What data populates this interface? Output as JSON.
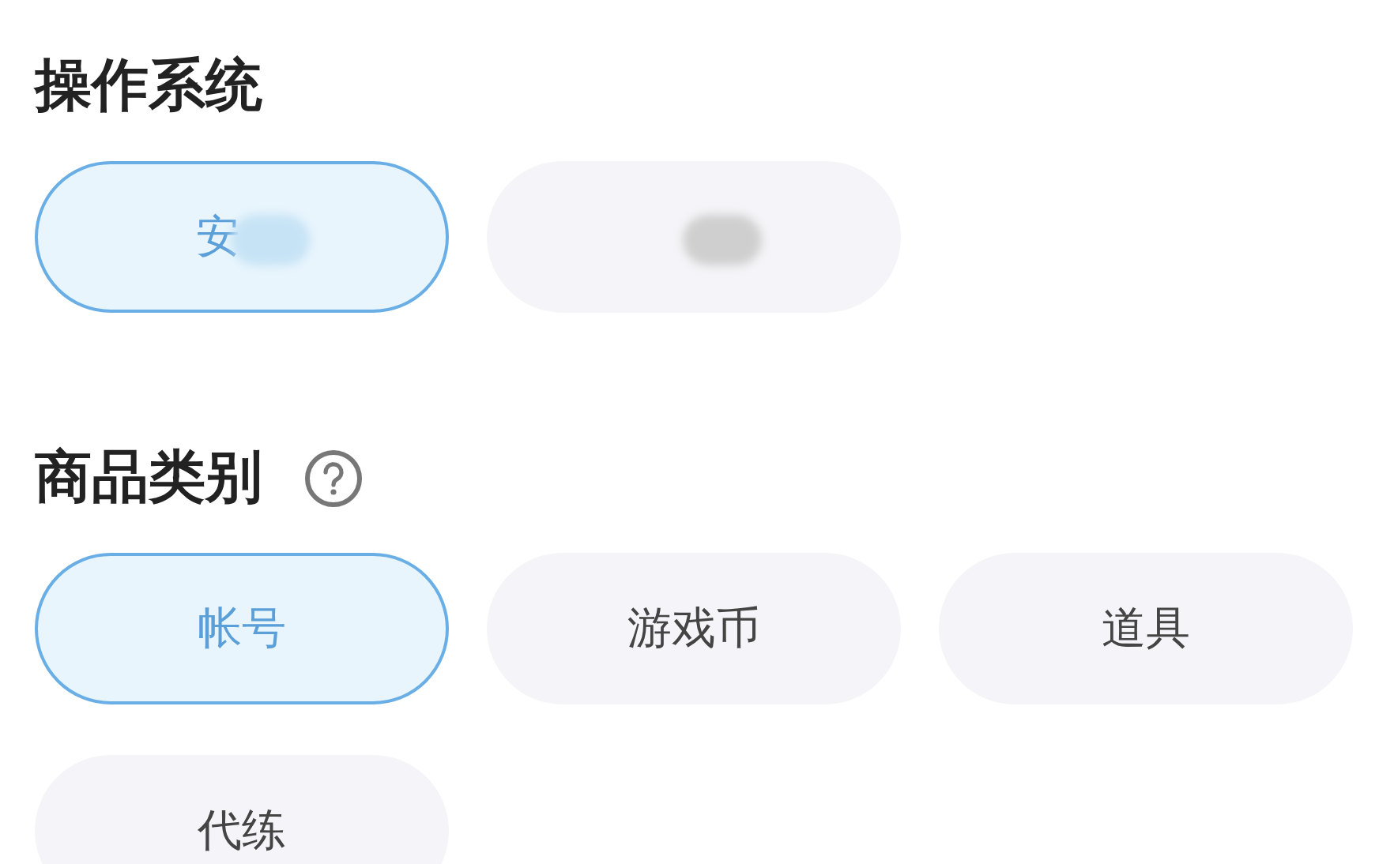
{
  "sections": [
    {
      "title": "操作系统",
      "help": false,
      "options": [
        {
          "label": "安",
          "selected": true,
          "redacted": true
        },
        {
          "selected": false,
          "redacted": true
        }
      ]
    },
    {
      "title": "商品类别",
      "help": true,
      "options": [
        {
          "label": "帐号",
          "selected": true,
          "redacted": false
        },
        {
          "label": "游戏币",
          "selected": false,
          "redacted": false
        },
        {
          "label": "道具",
          "selected": false,
          "redacted": false
        },
        {
          "label": "代练",
          "selected": false,
          "redacted": false
        }
      ]
    }
  ]
}
